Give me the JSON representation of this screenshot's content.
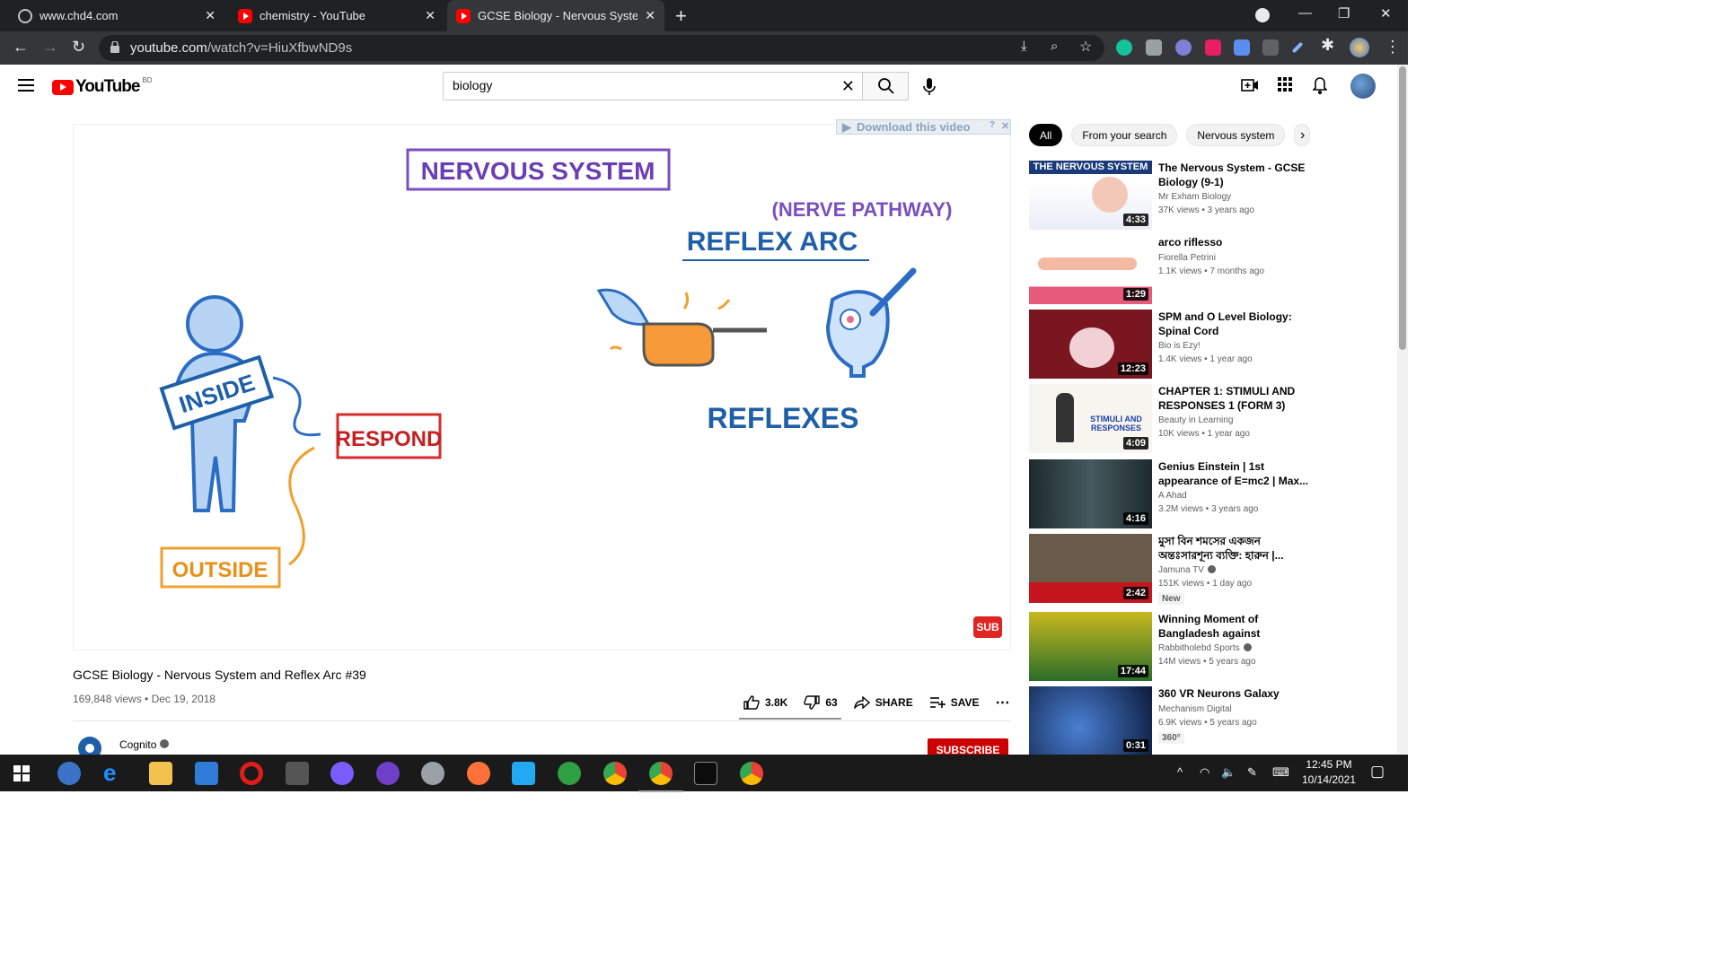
{
  "browser": {
    "tabs": [
      {
        "title": "www.chd4.com",
        "favicon": "globe-icon"
      },
      {
        "title": "chemistry - YouTube",
        "favicon": "youtube-icon"
      },
      {
        "title": "GCSE Biology - Nervous System a",
        "favicon": "youtube-icon"
      }
    ],
    "address": {
      "host": "youtube.com",
      "path": "/watch?v=HiuXfbwND9s"
    }
  },
  "youtube": {
    "logo_text": "YouTube",
    "country_code": "BD",
    "search_value": "biology",
    "search_placeholder": "Search"
  },
  "player": {
    "download_banner": "Download this video",
    "sub_badge": "SUB",
    "video_text": {
      "nervous_system": "NERVOUS SYSTEM",
      "nerve_pathway": "(NERVE PATHWAY)",
      "reflex_arc": "REFLEX ARC",
      "inside": "INSIDE",
      "respond": "RESPOND",
      "outside": "OUTSIDE",
      "reflexes": "REFLEXES"
    }
  },
  "video": {
    "title": "GCSE Biology - Nervous System and Reflex Arc #39",
    "meta": "169,848 views • Dec 19, 2018",
    "likes": "3.8K",
    "dislikes": "63",
    "share": "SHARE",
    "save": "SAVE",
    "channel": "Cognito",
    "subscribe": "SUBSCRIBE"
  },
  "chips": [
    "All",
    "From your search",
    "Nervous system"
  ],
  "recommendations": [
    {
      "title": "The Nervous System - GCSE Biology (9-1)",
      "channel": "Mr Exham Biology",
      "views": "37K views • 3 years ago",
      "duration": "4:33",
      "thumb_text": "THE NERVOUS SYSTEM",
      "verified": false,
      "badge": ""
    },
    {
      "title": "arco riflesso",
      "channel": "Fiorella Petrini",
      "views": "1.1K views • 7 months ago",
      "duration": "1:29",
      "verified": false,
      "badge": ""
    },
    {
      "title": "SPM and O Level Biology: Spinal Cord",
      "channel": "Bio is Ezy!",
      "views": "1.4K views • 1 year ago",
      "duration": "12:23",
      "verified": false,
      "badge": ""
    },
    {
      "title": "CHAPTER 1: STIMULI AND RESPONSES 1 (FORM 3)",
      "channel": "Beauty in Learning",
      "views": "10K views • 1 year ago",
      "duration": "4:09",
      "thumb_text": "STIMULI AND RESPONSES",
      "verified": false,
      "badge": ""
    },
    {
      "title": "Genius Einstein | 1st appearance of E=mc2 | Max...",
      "channel": "A Ahad",
      "views": "3.2M views • 3 years ago",
      "duration": "4:16",
      "verified": false,
      "badge": ""
    },
    {
      "title": "মুসা বিন শমসের একজন অন্তঃসারশূন্য ব্যক্তি: হারুন |...",
      "channel": "Jamuna TV",
      "views": "151K views • 1 day ago",
      "duration": "2:42",
      "verified": true,
      "badge": "New"
    },
    {
      "title": "Winning Moment of Bangladesh against Pakistan...",
      "channel": "Rabbitholebd Sports",
      "views": "14M views • 5 years ago",
      "duration": "17:44",
      "verified": true,
      "badge": ""
    },
    {
      "title": "360 VR Neurons Galaxy",
      "channel": "Mechanism Digital",
      "views": "6.9K views • 5 years ago",
      "duration": "0:31",
      "verified": false,
      "badge": "360°"
    }
  ],
  "taskbar": {
    "time": "12:45 PM",
    "date": "10/14/2021"
  }
}
